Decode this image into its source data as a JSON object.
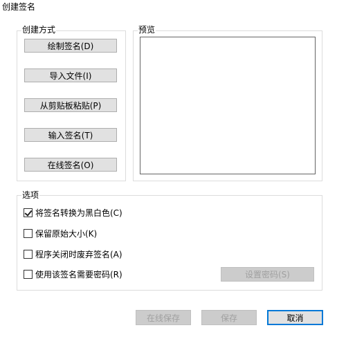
{
  "window": {
    "title": "创建签名"
  },
  "create_method": {
    "label": "创建方式",
    "buttons": [
      "绘制签名(D)",
      "导入文件(I)",
      "从剪贴板粘贴(P)",
      "输入签名(T)",
      "在线签名(O)"
    ]
  },
  "preview": {
    "label": "预览"
  },
  "options": {
    "label": "选项",
    "items": [
      {
        "label": "将签名转换为黑白色(C)",
        "checked": true
      },
      {
        "label": "保留原始大小(K)",
        "checked": false
      },
      {
        "label": "程序关闭时废弃签名(A)",
        "checked": false
      },
      {
        "label": "使用该签名需要密码(R)",
        "checked": false
      }
    ],
    "set_password": {
      "label": "设置密码(S)",
      "disabled": true
    }
  },
  "footer": {
    "online_save": "在线保存",
    "save": "保存",
    "cancel": "取消"
  }
}
